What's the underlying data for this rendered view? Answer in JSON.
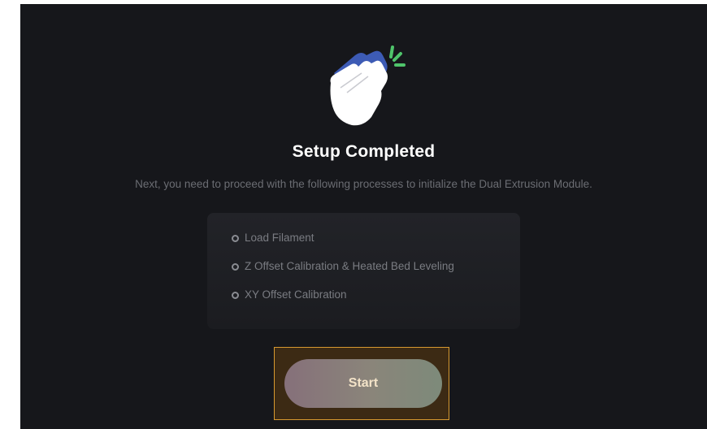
{
  "dialog": {
    "title": "Setup Completed",
    "subtitle": "Next, you need to proceed with the following processes to initialize the Dual Extrusion Module.",
    "icon": "clapping-hands-icon",
    "processes": [
      {
        "label": "Load Filament"
      },
      {
        "label": "Z Offset Calibration & Heated Bed Leveling"
      },
      {
        "label": "XY Offset Calibration"
      }
    ],
    "start_label": "Start"
  },
  "colors": {
    "background": "#16171b",
    "title": "#ffffff",
    "muted_text": "#6b6d73",
    "highlight_border": "#d89a30",
    "icon_blue": "#3d5bb5",
    "icon_green": "#4fc46b"
  }
}
